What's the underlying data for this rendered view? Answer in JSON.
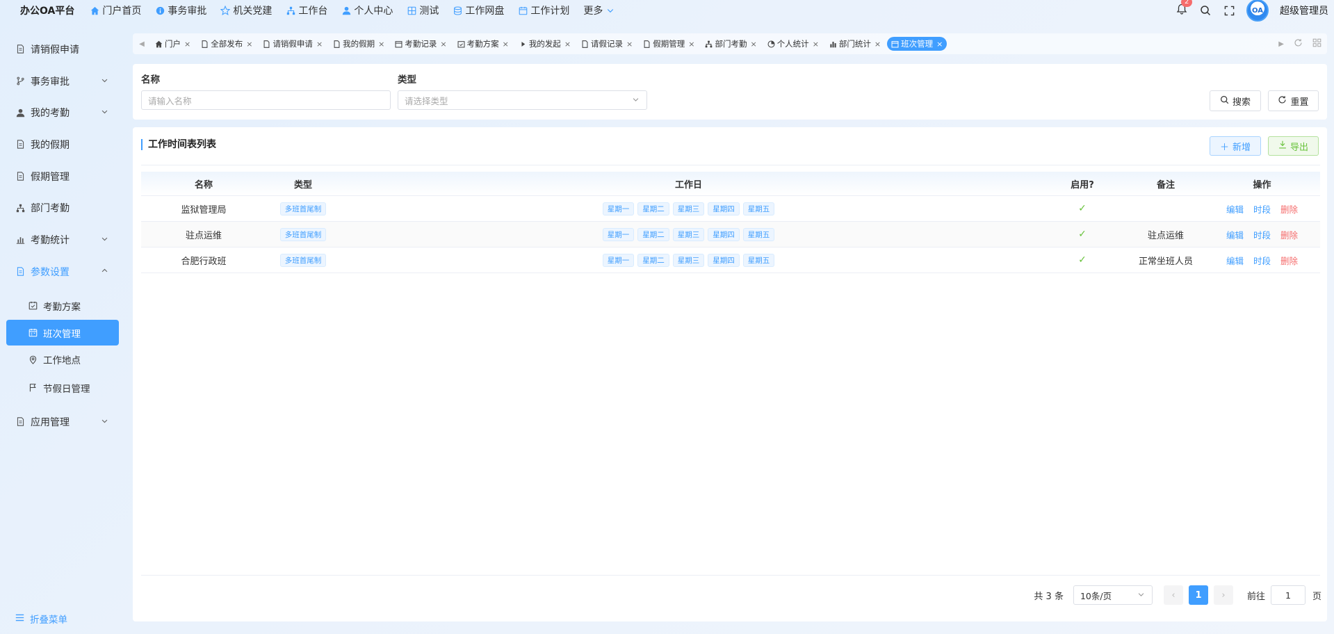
{
  "app": {
    "brand": "办公OA平台",
    "username": "超级管理员",
    "notification_count": "2",
    "avatar_text": "OA"
  },
  "topnav": [
    {
      "label": "门户首页",
      "icon": "home-icon"
    },
    {
      "label": "事务审批",
      "icon": "info-icon"
    },
    {
      "label": "机关党建",
      "icon": "star-icon"
    },
    {
      "label": "工作台",
      "icon": "org-chart-icon"
    },
    {
      "label": "个人中心",
      "icon": "user-icon"
    },
    {
      "label": "测试",
      "icon": "grid-icon"
    },
    {
      "label": "工作网盘",
      "icon": "database-icon"
    },
    {
      "label": "工作计划",
      "icon": "calendar-icon"
    },
    {
      "label": "更多",
      "icon": "chevron-down-icon"
    }
  ],
  "sidebar": {
    "items": [
      {
        "label": "请销假申请",
        "icon": "document-icon"
      },
      {
        "label": "事务审批",
        "icon": "branch-icon"
      },
      {
        "label": "我的考勤",
        "icon": "user-icon"
      },
      {
        "label": "我的假期",
        "icon": "document-icon"
      },
      {
        "label": "假期管理",
        "icon": "document-icon"
      },
      {
        "label": "部门考勤",
        "icon": "org-chart-icon"
      },
      {
        "label": "考勤统计",
        "icon": "bar-chart-icon"
      },
      {
        "label": "参数设置",
        "icon": "document-icon"
      },
      {
        "label": "应用管理",
        "icon": "document-icon"
      }
    ],
    "sub_items": [
      {
        "label": "考勤方案",
        "icon": "calendar-check-icon"
      },
      {
        "label": "班次管理",
        "icon": "calendar-icon"
      },
      {
        "label": "工作地点",
        "icon": "location-icon"
      },
      {
        "label": "节假日管理",
        "icon": "flag-icon"
      }
    ],
    "collapse_label": "折叠菜单"
  },
  "tabs": [
    {
      "label": "门户",
      "icon": "home-icon"
    },
    {
      "label": "全部发布",
      "icon": "document-icon"
    },
    {
      "label": "请销假申请",
      "icon": "document-icon"
    },
    {
      "label": "我的假期",
      "icon": "document-icon"
    },
    {
      "label": "考勤记录",
      "icon": "calendar-icon"
    },
    {
      "label": "考勤方案",
      "icon": "calendar-check-icon"
    },
    {
      "label": "我的发起",
      "icon": "play-icon"
    },
    {
      "label": "请假记录",
      "icon": "document-icon"
    },
    {
      "label": "假期管理",
      "icon": "document-icon"
    },
    {
      "label": "部门考勤",
      "icon": "org-chart-icon"
    },
    {
      "label": "个人统计",
      "icon": "pie-chart-icon"
    },
    {
      "label": "部门统计",
      "icon": "bar-chart-icon"
    },
    {
      "label": "班次管理",
      "icon": "calendar-icon",
      "active": true
    }
  ],
  "search": {
    "name_label": "名称",
    "name_placeholder": "请输入名称",
    "type_label": "类型",
    "type_placeholder": "请选择类型",
    "search_button": "搜索",
    "reset_button": "重置"
  },
  "table": {
    "title": "工作时间表列表",
    "add_button": "新增",
    "export_button": "导出",
    "columns": [
      "名称",
      "类型",
      "工作日",
      "启用?",
      "备注",
      "操作"
    ],
    "rows": [
      {
        "name": "监狱管理局",
        "type": "多班首尾制",
        "days": [
          "星期一",
          "星期二",
          "星期三",
          "星期四",
          "星期五"
        ],
        "enabled": true,
        "note": ""
      },
      {
        "name": "驻点运维",
        "type": "多班首尾制",
        "days": [
          "星期一",
          "星期二",
          "星期三",
          "星期四",
          "星期五"
        ],
        "enabled": true,
        "note": "驻点运维"
      },
      {
        "name": "合肥行政班",
        "type": "多班首尾制",
        "days": [
          "星期一",
          "星期二",
          "星期三",
          "星期四",
          "星期五"
        ],
        "enabled": true,
        "note": "正常坐班人员"
      }
    ],
    "actions": {
      "edit": "编辑",
      "period": "时段",
      "delete": "删除"
    }
  },
  "pagination": {
    "total": "共 3 条",
    "page_size": "10条/页",
    "current_page": "1",
    "goto_label": "前往",
    "goto_value": "1",
    "page_suffix": "页"
  },
  "colors": {
    "primary": "#409eff",
    "success": "#67c23a",
    "danger": "#f56c6c"
  }
}
